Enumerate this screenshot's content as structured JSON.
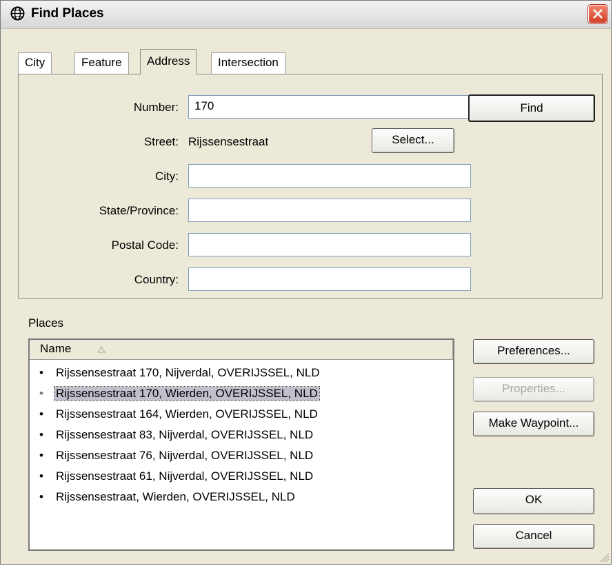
{
  "window": {
    "title": "Find Places",
    "icon": "globe-icon",
    "close_icon": "close-icon"
  },
  "tabs": [
    {
      "label": "City",
      "active": false
    },
    {
      "label": "Feature",
      "active": false
    },
    {
      "label": "Address",
      "active": true
    },
    {
      "label": "Intersection",
      "active": false
    }
  ],
  "address": {
    "number_label": "Number:",
    "number_value": "170",
    "street_label": "Street:",
    "street_value": "Rijssensestraat",
    "select_button": "Select...",
    "city_label": "City:",
    "city_value": "",
    "state_label": "State/Province:",
    "state_value": "",
    "postal_label": "Postal Code:",
    "postal_value": "",
    "country_label": "Country:",
    "country_value": ""
  },
  "find_button": "Find",
  "places": {
    "group_label": "Places",
    "column_name": "Name",
    "items": [
      "Rijssensestraat 170, Nijverdal, OVERIJSSEL, NLD",
      "Rijssensestraat 170, Wierden, OVERIJSSEL, NLD",
      "Rijssensestraat 164, Wierden, OVERIJSSEL, NLD",
      "Rijssensestraat 83, Nijverdal, OVERIJSSEL, NLD",
      "Rijssensestraat 76, Nijverdal, OVERIJSSEL, NLD",
      "Rijssensestraat 61, Nijverdal, OVERIJSSEL, NLD",
      "Rijssensestraat, Wierden, OVERIJSSEL, NLD"
    ],
    "bullet": "•"
  },
  "buttons": {
    "preferences": "Preferences...",
    "properties": "Properties...",
    "make_waypoint": "Make Waypoint...",
    "ok": "OK",
    "cancel": "Cancel"
  }
}
